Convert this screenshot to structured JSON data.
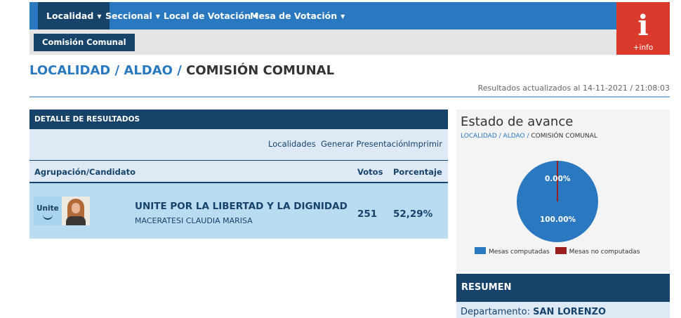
{
  "nav": {
    "items": [
      {
        "label": "Localidad"
      },
      {
        "label": "Seccional"
      },
      {
        "label": "Local de Votación"
      },
      {
        "label": "Mesa de Votación"
      }
    ],
    "sub_item": "Comisión Comunal",
    "info_big": "i",
    "info_small": "+info",
    "caret": "▼"
  },
  "page": {
    "crumb_1": "LOCALIDAD",
    "crumb_2": "ALDAO",
    "current": "COMISIÓN COMUNAL",
    "separator": "/",
    "updated": "Resultados actualizados al 14-11-2021 / 21:08:03"
  },
  "results": {
    "header": "DETALLE DE RESULTADOS",
    "actions": [
      "Localidades",
      "Generar Presentación",
      "Imprimir"
    ],
    "columns": {
      "group": "Agrupación/Candidato",
      "votes": "Votos",
      "percent": "Porcentaje"
    },
    "rows": [
      {
        "logo_text": "Unite",
        "party": "UNITE POR LA LIBERTAD Y LA DIGNIDAD",
        "candidate": "MACERATESI CLAUDIA MARISA",
        "votes": "251",
        "percent": "52,29%"
      }
    ]
  },
  "avance": {
    "title": "Estado de avance",
    "crumb_1": "LOCALIDAD",
    "crumb_2": "ALDAO",
    "current": "COMISIÓN COMUNAL",
    "separator": "/",
    "pie": {
      "computed_pct": 100,
      "not_computed_pct": 0,
      "label_computed": "100.00%",
      "label_not_computed": "0.00%",
      "color_computed": "#2a78c0",
      "color_not_computed": "#9a1f1f"
    },
    "legend": [
      "Mesas computadas",
      "Mesas no computadas"
    ]
  },
  "resumen": {
    "header": "RESUMEN",
    "dept_label": "Departamento:",
    "dept_value": "SAN LORENZO"
  }
}
